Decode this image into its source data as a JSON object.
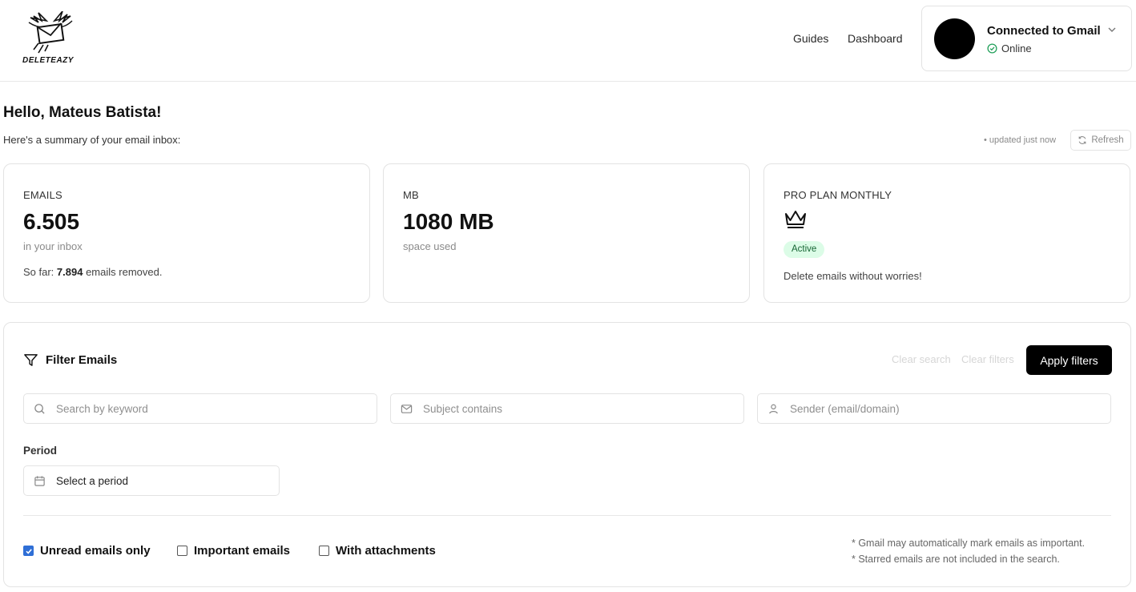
{
  "header": {
    "logo_text": "DELETEAZY",
    "nav": [
      {
        "label": "Guides"
      },
      {
        "label": "Dashboard"
      }
    ],
    "gmail": {
      "title": "Connected to Gmail",
      "status": "Online"
    }
  },
  "greeting": {
    "title": "Hello, Mateus Batista!",
    "summary": "Here's a summary of your email inbox:",
    "updated": "• updated just now",
    "refresh_label": "Refresh"
  },
  "cards": {
    "emails": {
      "label": "EMAILS",
      "value": "6.505",
      "sub": "in your inbox",
      "foot_prefix": "So far: ",
      "foot_count": "7.894",
      "foot_suffix": " emails removed."
    },
    "mb": {
      "label": "MB",
      "value": "1080 MB",
      "sub": "space used"
    },
    "plan": {
      "label": "PRO PLAN MONTHLY",
      "badge": "Active",
      "foot": "Delete emails without worries!",
      "icon": "crown-icon"
    }
  },
  "filters": {
    "title": "Filter Emails",
    "clear_search": "Clear search",
    "clear_filters": "Clear filters",
    "apply": "Apply filters",
    "keyword": {
      "placeholder": "Search by keyword",
      "value": ""
    },
    "subject": {
      "placeholder": "Subject contains",
      "value": ""
    },
    "sender": {
      "placeholder": "Sender (email/domain)",
      "value": ""
    },
    "period_label": "Period",
    "period_value": "Select a period",
    "checkboxes": [
      {
        "label": "Unread emails only",
        "checked": true
      },
      {
        "label": "Important emails",
        "checked": false
      },
      {
        "label": "With attachments",
        "checked": false
      }
    ],
    "notes": [
      "* Gmail may automatically mark emails as important.",
      "* Starred emails are not included in the search."
    ]
  },
  "colors": {
    "accent": "#000000",
    "checkbox": "#2f6fd6",
    "online": "#22a05a",
    "badge_bg": "#dcfce7",
    "badge_text": "#166534"
  }
}
